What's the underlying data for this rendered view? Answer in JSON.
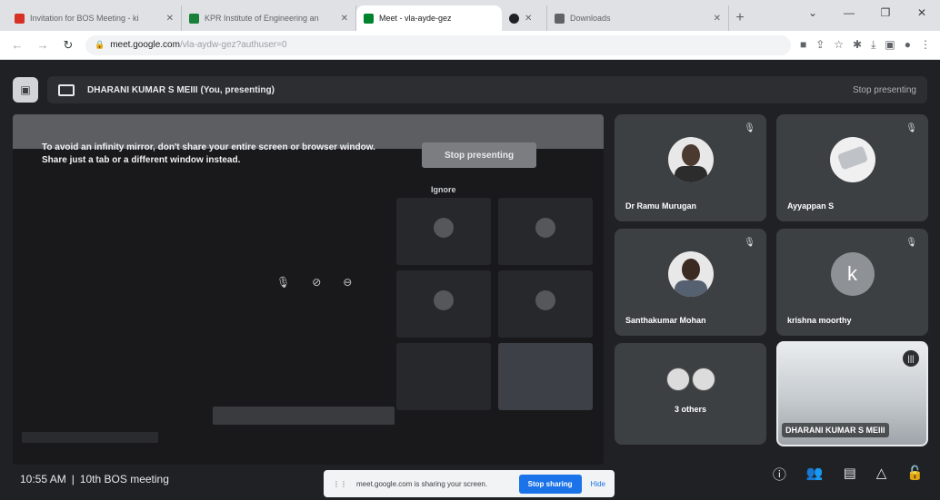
{
  "browser": {
    "tabs": [
      {
        "title": "Invitation for BOS Meeting - ki",
        "favicon_color": "#d93025",
        "active": false
      },
      {
        "title": "KPR Institute of Engineering an",
        "favicon_color": "#188038",
        "active": false
      },
      {
        "title": "Meet - vla-ayde-gez",
        "favicon_color": "#00832d",
        "active": true
      },
      {
        "title": "",
        "favicon_color": "#202124",
        "active": false
      },
      {
        "title": "Downloads",
        "favicon_color": "#5f6368",
        "active": false
      }
    ],
    "url_host": "meet.google.com",
    "url_path": "/vla-aydw-gez?authuser=0"
  },
  "meet": {
    "presenter_label": "DHARANI KUMAR S MEIII (You, presenting)",
    "stop_presenting_label": "Stop presenting",
    "stage": {
      "warning_text": "To avoid an infinity mirror, don't share your entire screen or browser window. Share just a tab or a different window instead.",
      "stop_button_label": "Stop presenting",
      "ignore_label": "Ignore"
    },
    "participants": [
      {
        "name": "Dr Ramu Murugan",
        "kind": "photo"
      },
      {
        "name": "Ayyappan S",
        "kind": "photo"
      },
      {
        "name": "Santhakumar Mohan",
        "kind": "photo"
      },
      {
        "name": "krishna moorthy",
        "kind": "letter",
        "letter": "k"
      },
      {
        "name": "3 others",
        "kind": "group"
      },
      {
        "name": "DHARANI KUMAR S MEIII",
        "kind": "video"
      }
    ],
    "clock": "10:55 AM",
    "separator": "|",
    "meeting_title": "10th BOS meeting",
    "share_notice": {
      "text": "meet.google.com is sharing your screen.",
      "stop_label": "Stop sharing",
      "hide_label": "Hide"
    }
  }
}
